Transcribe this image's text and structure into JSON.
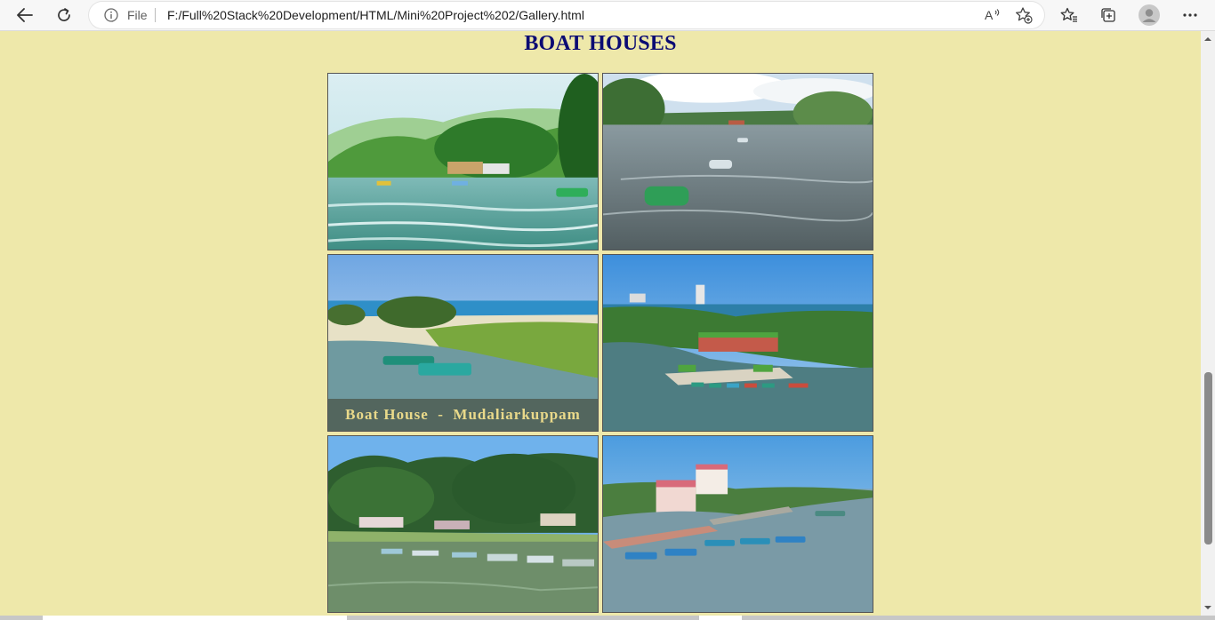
{
  "browser": {
    "file_label": "File",
    "url": "F:/Full%20Stack%20Development/HTML/Mini%20Project%202/Gallery.html",
    "icons": {
      "back": "back-arrow-icon",
      "refresh": "refresh-icon",
      "info": "info-icon",
      "read_aloud": "read-aloud-icon",
      "add_favorite": "add-favorite-icon",
      "favorites": "favorites-icon",
      "collections": "collections-icon",
      "profile": "profile-avatar-icon",
      "menu": "more-menu-icon"
    }
  },
  "page": {
    "background": "#eee8aa",
    "title": "BOAT HOUSES",
    "title_color": "#0b0b73",
    "photos": [
      {
        "caption": ""
      },
      {
        "caption": ""
      },
      {
        "caption": "Boat House  -  Mudaliarkuppam"
      },
      {
        "caption": ""
      },
      {
        "caption": ""
      },
      {
        "caption": ""
      }
    ]
  }
}
